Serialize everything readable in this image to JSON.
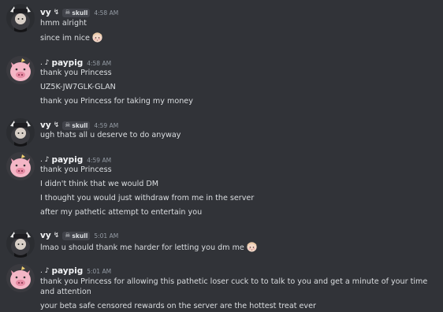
{
  "users": {
    "vy": {
      "name": "vy",
      "decoration": "↯",
      "tag_icon": "skull-icon",
      "tag_label": "skull"
    },
    "paypig": {
      "name": "paypig",
      "prefix": ". ♪"
    }
  },
  "messages": [
    {
      "time": "4:58 AM",
      "lines": [
        "hmm alright",
        "since im nice"
      ]
    },
    {
      "time": "4:58 AM",
      "lines": [
        "thank you Princess",
        "UZ5K-JW7GLK-GLAN",
        "thank you Princess for taking my money"
      ]
    },
    {
      "time": "4:59 AM",
      "lines": [
        "ugh thats all u deserve to do anyway"
      ]
    },
    {
      "time": "4:59 AM",
      "lines": [
        "thank you Princess",
        "I didn't think that we would DM",
        "I thought you would just withdraw from me in the server",
        "after my pathetic attempt to entertain you"
      ]
    },
    {
      "time": "5:01 AM",
      "lines": [
        "lmao u should thank me harder for letting you dm me"
      ]
    },
    {
      "time": "5:01 AM",
      "lines": [
        "thank you Princess for allowing this pathetic loser cuck to to talk to you and get a minute of your time and attention",
        "your beta safe censored rewards on the server are the hottest treat ever"
      ]
    }
  ],
  "colors": {
    "background": "#313338",
    "text": "#dbdee1",
    "muted": "#949ba4",
    "username": "#f2f3f5",
    "tag_bg": "#41434a"
  }
}
